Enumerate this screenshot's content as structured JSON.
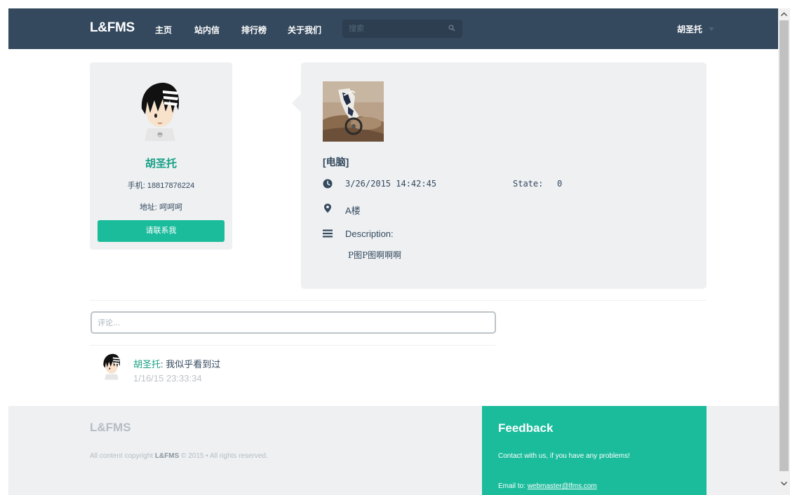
{
  "navbar": {
    "brand": "L&FMS",
    "links": [
      "主页",
      "站内信",
      "排行榜",
      "关于我们"
    ],
    "search_placeholder": "搜索",
    "user": "胡圣托"
  },
  "profile": {
    "name": "胡圣托",
    "phone": "手机: 18817876224",
    "address": "地址: 呵呵呵",
    "contact_label": "请联系我"
  },
  "item": {
    "category": "[电脑]",
    "time": "3/26/2015 14:42:45",
    "state_label": "State:",
    "state_value": "0",
    "location": "A楼",
    "description_label": "Description:",
    "description": "P图P图啊啊啊"
  },
  "comments": {
    "placeholder": "评论...",
    "list": [
      {
        "author": "胡圣托",
        "separator": ": ",
        "text": "我似乎看到过",
        "time": "1/16/15 23:33:34"
      }
    ]
  },
  "footer": {
    "brand": "L&FMS",
    "copy_prefix": "All content copyright ",
    "copy_brand": "L&FMS",
    "copy_suffix": " © 2015 • All rights reserved.",
    "feedback_title": "Feedback",
    "feedback_text": "Contact with us, if you have any problems!",
    "email_prefix": "Email to: ",
    "email": "webmaster@lfms.com"
  },
  "colors": {
    "navbar": "#34495e",
    "accent": "#1abc9c",
    "accent_text": "#16a085",
    "card_bg": "#eef0f2"
  },
  "icons": [
    "search-icon",
    "clock-icon",
    "map-marker-icon",
    "list-icon",
    "caret-down-icon",
    "scroll-up-arrow-icon",
    "scroll-down-arrow-icon"
  ]
}
